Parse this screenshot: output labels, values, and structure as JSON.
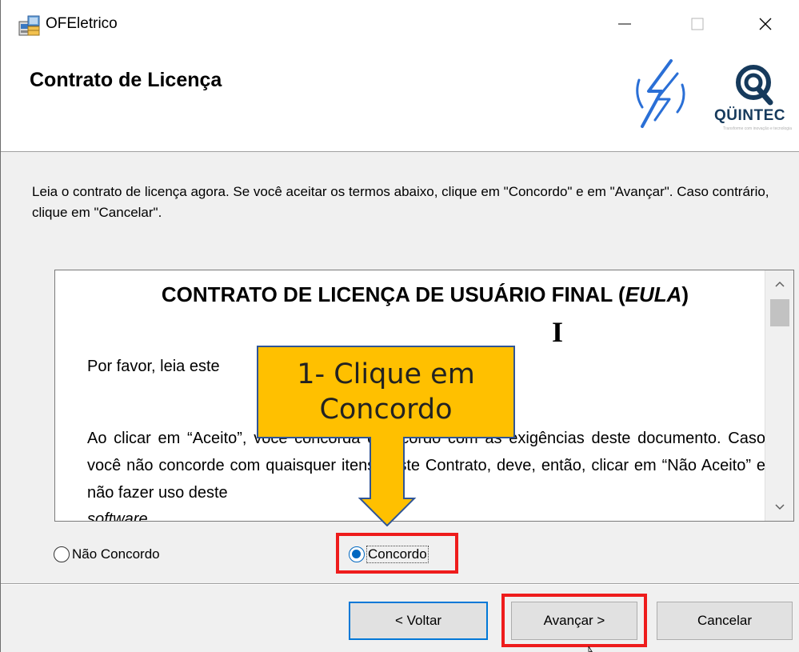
{
  "window": {
    "title": "OFEletrico",
    "controls": {
      "minimize": "—",
      "maximize": "☐",
      "close": "✕"
    }
  },
  "header": {
    "title": "Contrato de Licença",
    "logo_text": "QÜINTEC",
    "logo_subtext": "Transforme com inovação e tecnologia",
    "accent_color": "#163a5c"
  },
  "instructions": "Leia o contrato de licença agora. Se você aceitar os termos abaixo, clique em \"Concordo\" e em \"Avançar\". Caso contrário, clique em \"Cancelar\".",
  "eula": {
    "heading_prefix": "CONTRATO DE LICENÇA DE USUÁRIO FINAL (",
    "heading_italic": "EULA",
    "heading_suffix": ")",
    "paragraph1": "Por favor, leia este",
    "paragraph2": "Ao clicar em “Aceito”, você concorda de acordo com as exigências deste documento. Caso você não concorde com quaisquer itens deste Contrato, deve, então, clicar em “Não Aceito” e não fazer uso deste",
    "paragraph3": "software"
  },
  "options": {
    "disagree_label": "Não Concordo",
    "agree_label": "Concordo",
    "selected": "agree"
  },
  "buttons": {
    "back": "< Voltar",
    "next": "Avançar >",
    "cancel": "Cancelar"
  },
  "annotation": {
    "callout_line1": "1- Clique em",
    "callout_line2": "Concordo",
    "callout_color": "#ffc000",
    "highlight_color": "#ee1c1c"
  }
}
